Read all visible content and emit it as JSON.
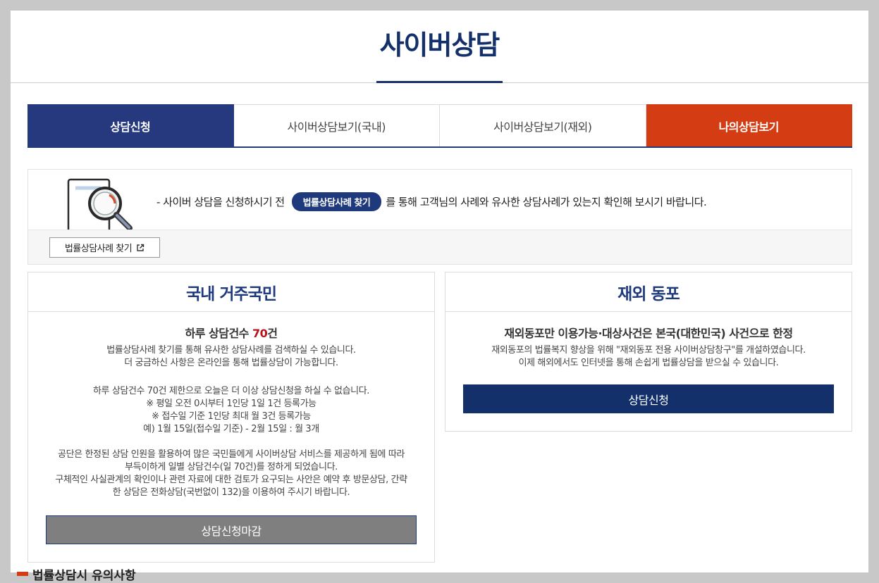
{
  "page": {
    "title": "사이버상담"
  },
  "tabs": [
    {
      "label": "상담신청"
    },
    {
      "label": "사이버상담보기(국내)"
    },
    {
      "label": "사이버상담보기(재외)"
    },
    {
      "label": "나의상담보기"
    }
  ],
  "notice": {
    "prefix": "- 사이버 상담을 신청하시기 전",
    "pill_label": "법률상담사례 찾기",
    "suffix": "를 통해 고객님의 사례와 유사한 상담사례가 있는지 확인해 보시기 바랍니다.",
    "find_button": "법률상담사례 찾기"
  },
  "domestic": {
    "title": "국내 거주국민",
    "count_prefix": "하루 상담건수 ",
    "count_value": "70",
    "count_suffix": "건",
    "desc1": "법률상담사례 찾기를 통해 유사한 상담사례를 검색하실 수 있습니다.",
    "desc2": "더 궁금하신 사항은 온라인을 통해 법률상담이 가능합니다.",
    "limit1": "하루 상담건수 70건 제한으로 오늘은 더 이상 상담신청을 하실 수 없습니다.",
    "limit2": "※ 평일 오전 0시부터 1인당 1일 1건 등록가능",
    "limit3": "※ 접수일 기준 1인당 최대 월 3건 등록가능",
    "limit4": "예) 1월 15일(접수일 기준) - 2월 15일 : 월 3개",
    "info1": "공단은 한정된 상담 인원을 활용하여 많은 국민들에게 사이버상담 서비스를 제공하게 됨에 따라",
    "info2": "부득이하게 일별 상담건수(일 70건)를 정하게 되었습니다.",
    "info3": "구체적인 사실관계의 확인이나 관련 자료에 대한 검토가 요구되는 사안은 예약 후 방문상담, 간략",
    "info4": "한 상담은 전화상담(국번없이 132)을 이용하여 주시기 바랍니다.",
    "closed_button": "상담신청마감"
  },
  "overseas": {
    "title": "재외 동포",
    "subtitle": "재외동포만 이용가능·대상사건은 본국(대한민국) 사건으로 한정",
    "desc1": "재외동포의 법률복지 향상을 위해 \"재외동포 전용 사이버상담창구\"를 개설하였습니다.",
    "desc2": "이제 해외에서도 인터넷을 통해 손쉽게 법률상담을 받으실 수 있습니다.",
    "apply_button": "상담신청"
  },
  "footer": {
    "section_title": "법률상담시 유의사항"
  },
  "colors": {
    "navy": "#26387e",
    "orange": "#d43d13",
    "count_red": "#b8121b",
    "closed_gray": "#7f7f7f"
  }
}
